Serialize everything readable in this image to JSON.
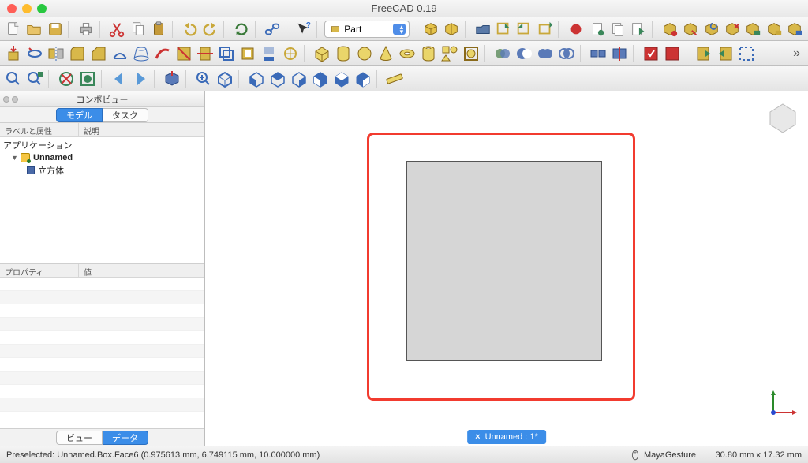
{
  "window": {
    "title": "FreeCAD 0.19"
  },
  "workbench": {
    "selected": "Part"
  },
  "combo": {
    "panel_title": "コンボビュー",
    "tab_model": "モデル",
    "tab_task": "タスク",
    "col_label": "ラベルと属性",
    "col_desc": "説明",
    "tree": {
      "app": "アプリケーション",
      "doc": "Unnamed",
      "item": "立方体"
    },
    "prop_col1": "プロパティ",
    "prop_col2": "値",
    "btab_view": "ビュー",
    "btab_data": "データ"
  },
  "doc_tab": {
    "label": "Unnamed : 1*"
  },
  "status": {
    "preselect": "Preselected: Unnamed.Box.Face6 (0.975613 mm, 6.749115 mm, 10.000000 mm)",
    "nav": "MayaGesture",
    "dims": "30.80 mm x 17.32 mm"
  }
}
